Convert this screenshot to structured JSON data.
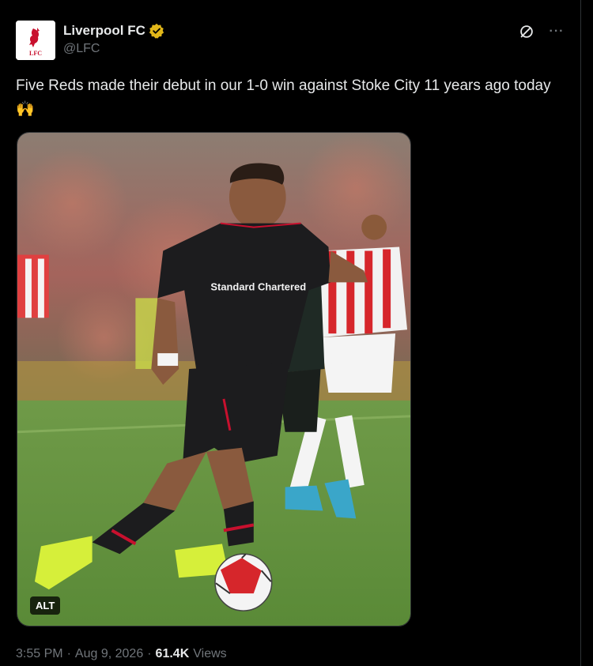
{
  "account": {
    "display_name": "Liverpool FC",
    "handle": "@LFC",
    "avatar_text": "LFC",
    "verified_color": "#e2b719"
  },
  "actions": {
    "grok_icon": "grok-icon",
    "more_icon": "more-icon",
    "more_glyph": "···"
  },
  "tweet": {
    "text": "Five Reds made their debut in our 1-0 win against Stoke City 11 years ago today",
    "emoji": "🙌"
  },
  "media": {
    "alt_label": "ALT",
    "shirt_sponsor": "Standard Chartered"
  },
  "meta": {
    "time": "3:55 PM",
    "separator": "·",
    "date": "Aug 9, 2026",
    "views_count": "61.4K",
    "views_label": "Views"
  },
  "colors": {
    "background": "#000000",
    "text": "#e7e9ea",
    "muted": "#71767b",
    "pitch": "#5f8f3e",
    "lfc_red": "#c8102e"
  }
}
